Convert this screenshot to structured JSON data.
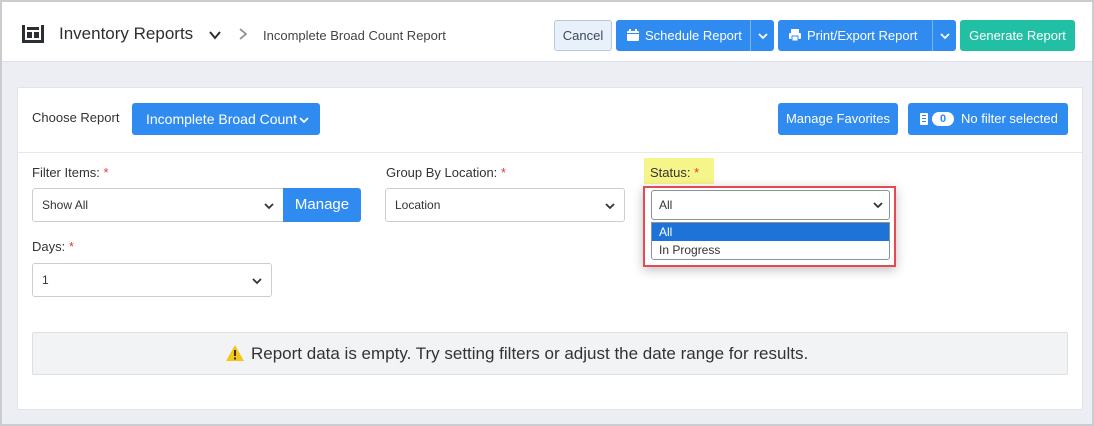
{
  "header": {
    "app_title": "Inventory Reports",
    "breadcrumb": "Incomplete Broad Count Report",
    "cancel_label": "Cancel",
    "schedule_label": "Schedule Report",
    "export_label": "Print/Export Report",
    "generate_label": "Generate Report"
  },
  "report_bar": {
    "choose_label": "Choose Report",
    "selected_report": "Incomplete Broad Count",
    "favorites_label": "Manage Favorites",
    "filter_count": "0",
    "filter_label": "No filter selected"
  },
  "filters": {
    "filter_items": {
      "label": "Filter Items:",
      "required_mark": "*",
      "value": "Show All",
      "manage_label": "Manage"
    },
    "group_by": {
      "label": "Group By Location:",
      "required_mark": "*",
      "value": "Location"
    },
    "status": {
      "label": "Status:",
      "required_mark": "*",
      "value": "All",
      "options": [
        "All",
        "In Progress"
      ],
      "selected_index": 0
    },
    "days": {
      "label": "Days:",
      "required_mark": "*",
      "value": "1"
    }
  },
  "empty_message": "Report data is empty. Try setting filters or adjust the date range for results.",
  "colors": {
    "primary": "#2f8bf0",
    "generate": "#21c0a5",
    "highlight_border": "#e24b54",
    "label_highlight": "#f6f58a",
    "warning": "#f5c518"
  },
  "icons": [
    "inventory-icon",
    "chevron-down-icon",
    "chevron-right-icon",
    "calendar-icon",
    "printer-icon",
    "filter-icon",
    "warning-icon"
  ]
}
